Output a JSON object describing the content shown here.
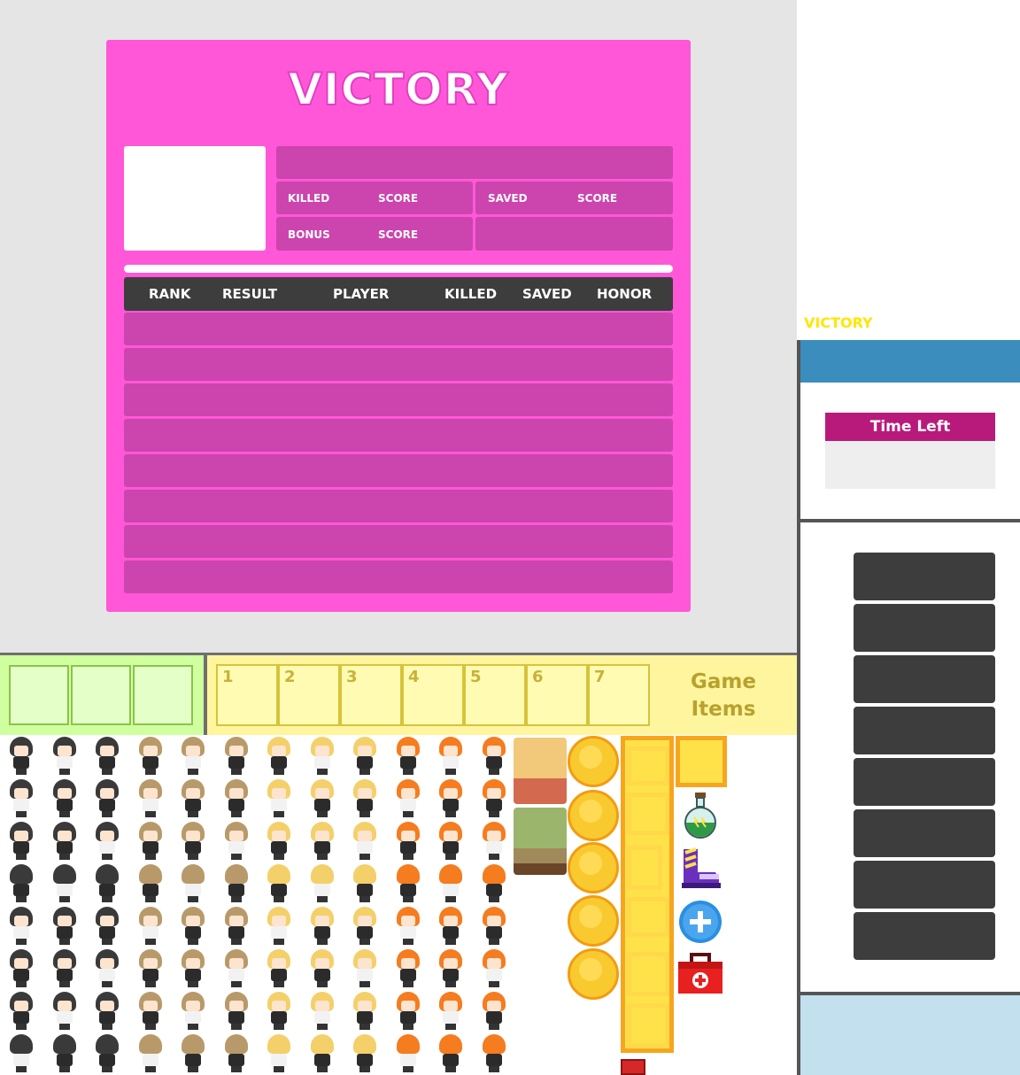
{
  "victory": {
    "title": "VICTORY",
    "stats": {
      "killed_label": "KILLED",
      "score_label_1": "SCORE",
      "saved_label": "SAVED",
      "score_label_2": "SCORE",
      "bonus_label": "BONUS",
      "score_label_3": "SCORE"
    },
    "table_headers": [
      "RANK",
      "RESULT",
      "PLAYER",
      "KILLED",
      "SAVED",
      "HONOR"
    ],
    "row_count": 8
  },
  "side": {
    "small_title": "VICTORY",
    "time_left_label": "Time Left",
    "button_count": 8
  },
  "hotbar": {
    "slot_numbers": [
      "1",
      "2",
      "3",
      "4",
      "5",
      "6",
      "7"
    ],
    "game_items_label": "Game Items"
  },
  "colors": {
    "panel": "#ff57d8",
    "panel_box": "#cc44ad",
    "header_dark": "#3d3d3d",
    "side_blue": "#3b8dbd",
    "time_left": "#b81a7b",
    "small_title": "#ffe600",
    "green_slots": "#cfff9f",
    "yellow_slots": "#fff59e"
  },
  "icons": [
    "character-sprite",
    "coin-icon",
    "potion-icon",
    "boot-icon",
    "plus-circle-icon",
    "medkit-icon"
  ]
}
